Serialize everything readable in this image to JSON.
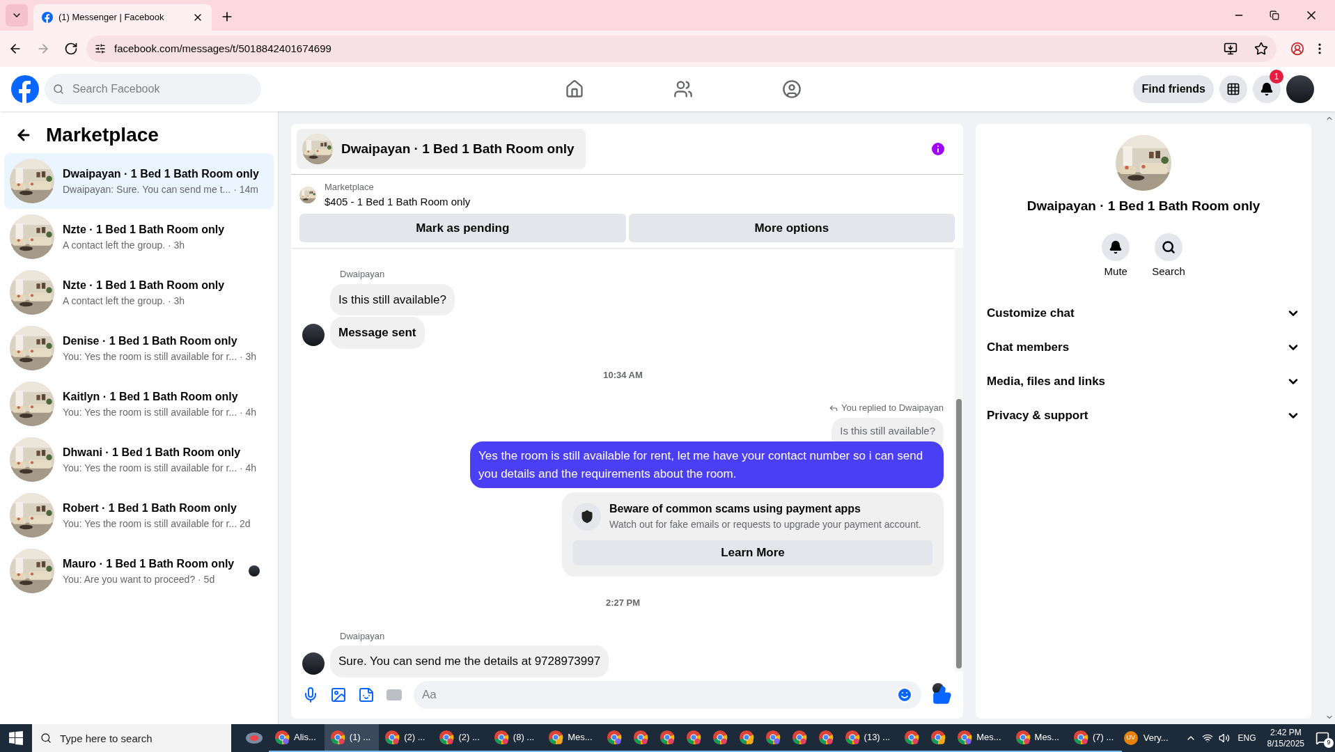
{
  "browser": {
    "tab_title": "(1) Messenger | Facebook",
    "url": "facebook.com/messages/t/5018842401674699"
  },
  "header": {
    "search_placeholder": "Search Facebook",
    "find_friends": "Find friends",
    "notification_badge": "1"
  },
  "sidebar": {
    "title": "Marketplace",
    "conversations": [
      {
        "title": "Dwaipayan · 1 Bed 1 Bath Room only",
        "preview": "Dwaipayan: Sure. You can send me t... · 14m",
        "selected": true,
        "seen": false
      },
      {
        "title": "Nzte · 1 Bed 1 Bath Room only",
        "preview": "A contact left the group. · 3h",
        "selected": false,
        "seen": false
      },
      {
        "title": "Nzte · 1 Bed 1 Bath Room only",
        "preview": "A contact left the group. · 3h",
        "selected": false,
        "seen": false
      },
      {
        "title": "Denise · 1 Bed 1 Bath Room only",
        "preview": "You: Yes the room is still available for r... · 3h",
        "selected": false,
        "seen": false
      },
      {
        "title": "Kaitlyn · 1 Bed 1 Bath Room only",
        "preview": "You: Yes the room is still available for r... · 4h",
        "selected": false,
        "seen": false
      },
      {
        "title": "Dhwani · 1 Bed 1 Bath Room only",
        "preview": "You: Yes the room is still available for r... · 4h",
        "selected": false,
        "seen": false
      },
      {
        "title": "Robert · 1 Bed 1 Bath Room only",
        "preview": "You: Yes the room is still available for r... 2d",
        "selected": false,
        "seen": false
      },
      {
        "title": "Mauro · 1 Bed 1 Bath Room only",
        "preview": "You: Are you want to proceed? · 5d",
        "selected": false,
        "seen": true
      }
    ]
  },
  "chat": {
    "title": "Dwaipayan · 1 Bed 1 Bath Room only",
    "listing": {
      "label": "Marketplace",
      "price": "$405 - 1 Bed 1 Bath Room only"
    },
    "buttons": [
      "Mark as pending",
      "More options"
    ],
    "messages": [
      {
        "kind": "incoming",
        "sender": "Dwaipayan",
        "bubbles": [
          {
            "text": "Is this still available?",
            "bold": false
          },
          {
            "text": "Message sent",
            "bold": true
          }
        ]
      },
      {
        "kind": "timestamp",
        "text": "10:34 AM"
      },
      {
        "kind": "outgoing",
        "reply_label": "You replied to Dwaipayan",
        "quoted": "Is this still available?",
        "text": "Yes the room is still available for rent, let me have your contact number so i can send you details and the requirements about the room."
      },
      {
        "kind": "notice",
        "title": "Beware of common scams using payment apps",
        "body": "Watch out for fake emails or requests to upgrade your payment account.",
        "button": "Learn More"
      },
      {
        "kind": "timestamp",
        "text": "2:27 PM"
      },
      {
        "kind": "incoming",
        "sender": "Dwaipayan",
        "bubbles": [
          {
            "text": "Sure. You can send me the details at 9728973997",
            "bold": false
          }
        ]
      }
    ],
    "composer": {
      "placeholder": "Aa"
    }
  },
  "details": {
    "title": "Dwaipayan · 1 Bed 1 Bath Room only",
    "actions": [
      {
        "kind": "mute",
        "label": "Mute"
      },
      {
        "kind": "search",
        "label": "Search"
      }
    ],
    "sections": [
      "Customize chat",
      "Chat members",
      "Media, files and links",
      "Privacy & support"
    ]
  },
  "taskbar": {
    "search_placeholder": "Type here to search",
    "apps": [
      {
        "label": "Alis...",
        "active": false
      },
      {
        "label": "(1) ...",
        "active": true
      },
      {
        "label": "(2) ...",
        "active": false
      },
      {
        "label": "(2) ...",
        "active": false
      },
      {
        "label": "(8) ...",
        "active": false
      },
      {
        "label": "Mes...",
        "active": false
      },
      {
        "active": false
      },
      {
        "active": false
      },
      {
        "active": false
      },
      {
        "active": false
      },
      {
        "active": false
      },
      {
        "active": false
      },
      {
        "active": false
      },
      {
        "active": false
      },
      {
        "active": false
      },
      {
        "label": "(13) ...",
        "active": false
      },
      {
        "active": false
      },
      {
        "active": false
      },
      {
        "label": "Mes...",
        "active": false
      },
      {
        "label": "Mes...",
        "active": false
      },
      {
        "label": "(7) ...",
        "active": false
      }
    ],
    "weather": "Very...",
    "weather_badge": "UV",
    "language": "ENG",
    "time": "2:42 PM",
    "date": "8/15/2025",
    "notifications": "9"
  }
}
